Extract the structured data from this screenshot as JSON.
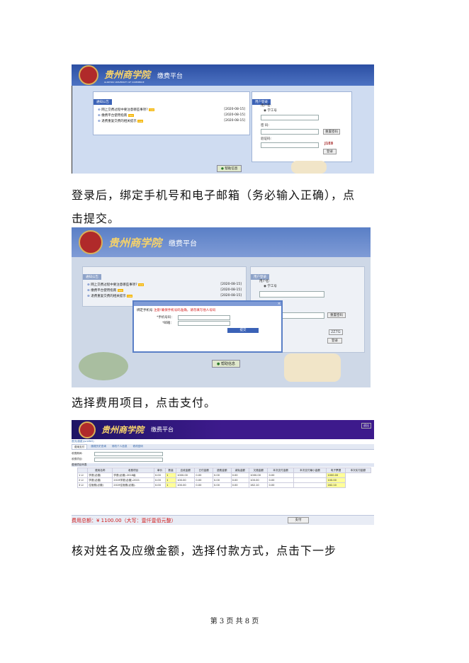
{
  "shot1": {
    "school": "贵州商学院",
    "school_en": "GUIZHOU UNIVERSITY OF COMMERCE",
    "platform": "缴费平台",
    "notice_header": "通知公告",
    "notices": [
      {
        "title": "网上交费过程中要注意哪些事项?",
        "badge": "new",
        "date": "[2020-08-15]"
      },
      {
        "title": "缴费平台使用指南",
        "badge": "new",
        "date": "[2020-08-15]"
      },
      {
        "title": "退费重复交费的相关提示",
        "badge": "new",
        "date": "[2020-08-15]"
      }
    ],
    "login_header": "用户登录",
    "username_label": "用户名:",
    "radio_label": "学工号",
    "password_label": "密 码:",
    "reset_label": "重置密码",
    "captcha_label": "验证码:",
    "captcha_value": "J1E8",
    "login_button": "登录",
    "help_label": "帮助信息"
  },
  "para1": "登录后，绑定手机号和电子邮箱（务必输入正确），点",
  "para1b": "击提交。",
  "shot2": {
    "dialog_title": "绑定手机号",
    "dialog_hint": "注意!确保手机号码准确，请勿填写他人号码",
    "phone_label": "*手机号码：",
    "email_label": "*邮箱：",
    "submit_label": "提交",
    "captcha_value": "2Z7G",
    "help_label": "帮助信息"
  },
  "para2": "选择费用项目，点击支付。",
  "shot3": {
    "school": "贵州商学院",
    "platform": "缴费平台",
    "top_right": "退出",
    "crumb": "首页(缴费)(unitNO)",
    "tabs": [
      "费用支付",
      "缴费历史查询",
      "修改个人信息",
      "修改密码"
    ],
    "filter1": "收费期间:",
    "filter2": "收费项目:",
    "list_header": "费用项目列表",
    "columns": [
      "",
      "费用名称",
      "收费项目",
      "单价",
      "数量",
      "应收金额",
      "已付金额",
      "退费金额",
      "减免金额",
      "欠费金额",
      "本次支付金额",
      "本次支付最小金额",
      "电子票据",
      "本次实付金额"
    ],
    "rows": [
      [
        "1",
        "学费(必缴)",
        "学费(必缴)-2018级",
        "0.00",
        "1",
        "1000.00",
        "0.00",
        "0.00",
        "0.00",
        "1000.00",
        "0.00",
        "",
        "1000.00"
      ],
      [
        "2",
        "学费(必缴)",
        "2019学费(必缴)-2021",
        "0.00",
        "1",
        "100.00",
        "0.00",
        "0.00",
        "0.00",
        "100.00",
        "0.00",
        "",
        "100.00"
      ],
      [
        "3",
        "住宿费(必缴)",
        "2019住宿费(必缴)-",
        "0.00",
        "1",
        "100.00",
        "0.00",
        "0.00",
        "0.00",
        "162.10",
        "0.00",
        "",
        "162.10"
      ]
    ],
    "total_label": "费用总额：",
    "total_value": "¥ 1100.00（大写：壹仟壹佰元整）",
    "pay_button": "支付"
  },
  "para3": "核对姓名及应缴金额，选择付款方式，点击下一步",
  "footer": "第 3 页 共 8 页",
  "colors": {
    "header_blue": "#2f52a6",
    "purple_header": "#3d1a8c",
    "total_red": "#d11a1a"
  }
}
